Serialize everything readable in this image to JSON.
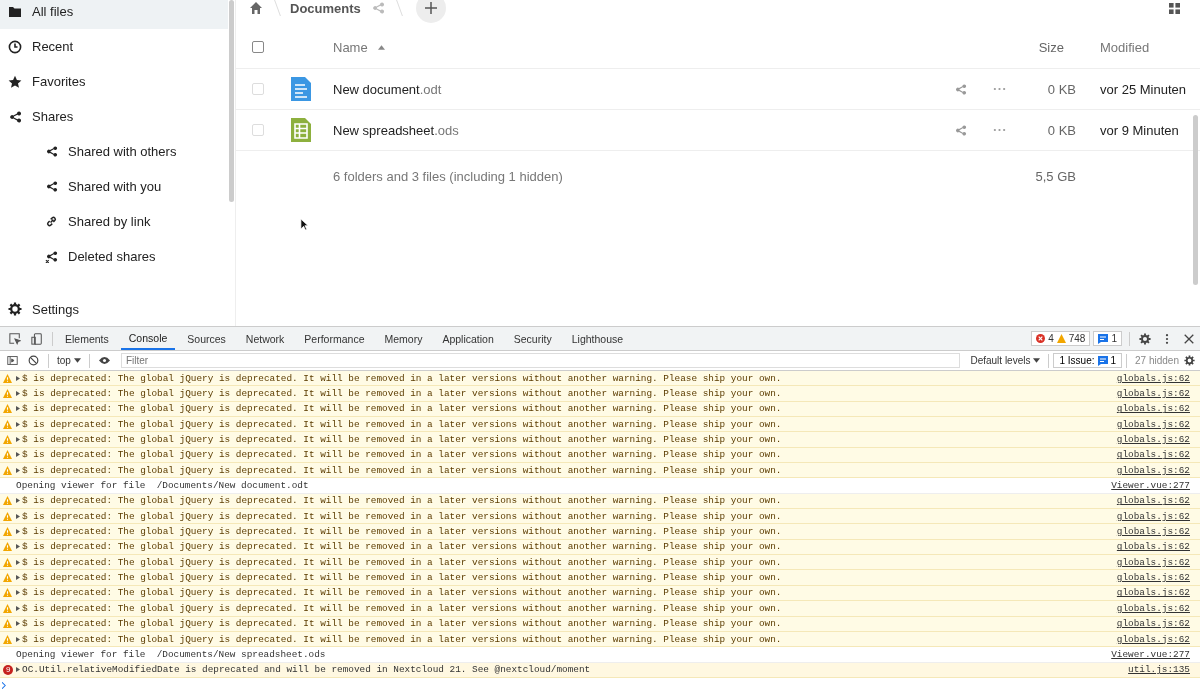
{
  "sidebar": {
    "items": [
      {
        "label": "All files",
        "kind": "folder",
        "selected": true
      },
      {
        "label": "Recent",
        "kind": "clock",
        "selected": false
      },
      {
        "label": "Favorites",
        "kind": "star",
        "selected": false
      },
      {
        "label": "Shares",
        "kind": "share",
        "selected": false,
        "children": [
          {
            "label": "Shared with others",
            "kind": "share",
            "selected": false
          },
          {
            "label": "Shared with you",
            "kind": "share",
            "selected": false
          },
          {
            "label": "Shared by link",
            "kind": "link",
            "selected": false
          },
          {
            "label": "Deleted shares",
            "kind": "deleted",
            "selected": false
          }
        ]
      }
    ],
    "settings": "Settings"
  },
  "breadcrumb": {
    "folder": "Documents"
  },
  "files": {
    "select_all_checked": false,
    "columns": {
      "name": "Name",
      "size": "Size",
      "modified": "Modified"
    },
    "rows": [
      {
        "base": "New document",
        "ext": ".odt",
        "kind": "document",
        "size": "0 KB",
        "modified": "vor 25 Minuten",
        "checked": false
      },
      {
        "base": "New spreadsheet",
        "ext": ".ods",
        "kind": "spreadsheet",
        "size": "0 KB",
        "modified": "vor 9 Minuten",
        "checked": false
      }
    ],
    "summary": "6 folders and 3 files (including 1 hidden)",
    "total_size": "5,5 GB"
  },
  "devtools": {
    "tabs": [
      {
        "label": "Elements",
        "selected": false
      },
      {
        "label": "Console",
        "selected": true
      },
      {
        "label": "Sources",
        "selected": false
      },
      {
        "label": "Network",
        "selected": false
      },
      {
        "label": "Performance",
        "selected": false
      },
      {
        "label": "Memory",
        "selected": false
      },
      {
        "label": "Application",
        "selected": false
      },
      {
        "label": "Security",
        "selected": false
      },
      {
        "label": "Lighthouse",
        "selected": false
      }
    ],
    "errors": "4",
    "warnings": "748",
    "messages": "1",
    "context": "top",
    "filter_placeholder": "Filter",
    "levels": "Default levels",
    "issues_label": "1 Issue:",
    "issues": "1",
    "hidden": "27 hidden",
    "log": [
      {
        "kind": "warning",
        "text": "$ is deprecated: The global jQuery is deprecated. It will be removed in a later versions without another warning. Please ship your own.",
        "source": "globals.js:62"
      },
      {
        "kind": "warning",
        "text": "$ is deprecated: The global jQuery is deprecated. It will be removed in a later versions without another warning. Please ship your own.",
        "source": "globals.js:62"
      },
      {
        "kind": "warning",
        "text": "$ is deprecated: The global jQuery is deprecated. It will be removed in a later versions without another warning. Please ship your own.",
        "source": "globals.js:62"
      },
      {
        "kind": "warning",
        "text": "$ is deprecated: The global jQuery is deprecated. It will be removed in a later versions without another warning. Please ship your own.",
        "source": "globals.js:62"
      },
      {
        "kind": "warning",
        "text": "$ is deprecated: The global jQuery is deprecated. It will be removed in a later versions without another warning. Please ship your own.",
        "source": "globals.js:62"
      },
      {
        "kind": "warning",
        "text": "$ is deprecated: The global jQuery is deprecated. It will be removed in a later versions without another warning. Please ship your own.",
        "source": "globals.js:62"
      },
      {
        "kind": "warning",
        "text": "$ is deprecated: The global jQuery is deprecated. It will be removed in a later versions without another warning. Please ship your own.",
        "source": "globals.js:62"
      },
      {
        "kind": "info",
        "text": "Opening viewer for file  /Documents/New document.odt",
        "source": "Viewer.vue:277"
      },
      {
        "kind": "warning",
        "text": "$ is deprecated: The global jQuery is deprecated. It will be removed in a later versions without another warning. Please ship your own.",
        "source": "globals.js:62"
      },
      {
        "kind": "warning",
        "text": "$ is deprecated: The global jQuery is deprecated. It will be removed in a later versions without another warning. Please ship your own.",
        "source": "globals.js:62"
      },
      {
        "kind": "warning",
        "text": "$ is deprecated: The global jQuery is deprecated. It will be removed in a later versions without another warning. Please ship your own.",
        "source": "globals.js:62"
      },
      {
        "kind": "warning",
        "text": "$ is deprecated: The global jQuery is deprecated. It will be removed in a later versions without another warning. Please ship your own.",
        "source": "globals.js:62"
      },
      {
        "kind": "warning",
        "text": "$ is deprecated: The global jQuery is deprecated. It will be removed in a later versions without another warning. Please ship your own.",
        "source": "globals.js:62"
      },
      {
        "kind": "warning",
        "text": "$ is deprecated: The global jQuery is deprecated. It will be removed in a later versions without another warning. Please ship your own.",
        "source": "globals.js:62"
      },
      {
        "kind": "warning",
        "text": "$ is deprecated: The global jQuery is deprecated. It will be removed in a later versions without another warning. Please ship your own.",
        "source": "globals.js:62"
      },
      {
        "kind": "warning",
        "text": "$ is deprecated: The global jQuery is deprecated. It will be removed in a later versions without another warning. Please ship your own.",
        "source": "globals.js:62"
      },
      {
        "kind": "warning",
        "text": "$ is deprecated: The global jQuery is deprecated. It will be removed in a later versions without another warning. Please ship your own.",
        "source": "globals.js:62"
      },
      {
        "kind": "warning",
        "text": "$ is deprecated: The global jQuery is deprecated. It will be removed in a later versions without another warning. Please ship your own.",
        "source": "globals.js:62"
      },
      {
        "kind": "info",
        "text": "Opening viewer for file  /Documents/New spreadsheet.ods",
        "source": "Viewer.vue:277"
      },
      {
        "kind": "error",
        "count": "9",
        "text": "OC.Util.relativeModifiedDate is deprecated and will be removed in Nextcloud 21. See @nextcloud/moment",
        "source": "util.js:135"
      }
    ]
  }
}
